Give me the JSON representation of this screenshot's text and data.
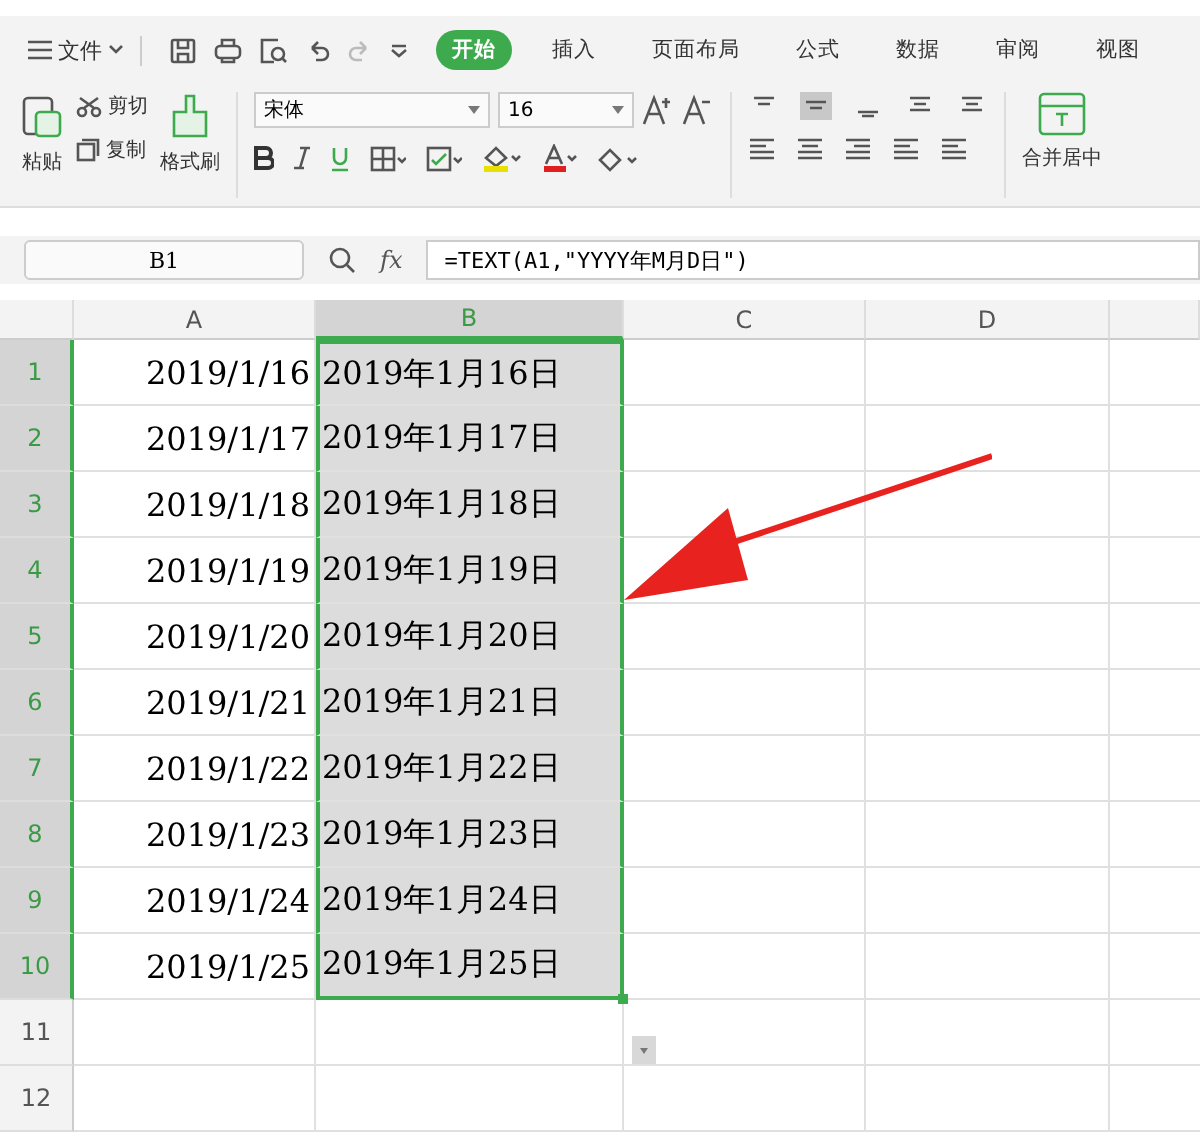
{
  "menu": {
    "file": "文件",
    "tabs": [
      {
        "label": "开始",
        "selected": true
      },
      {
        "label": "插入",
        "selected": false
      },
      {
        "label": "页面布局",
        "selected": false
      },
      {
        "label": "公式",
        "selected": false
      },
      {
        "label": "数据",
        "selected": false
      },
      {
        "label": "审阅",
        "selected": false
      },
      {
        "label": "视图",
        "selected": false
      }
    ]
  },
  "ribbon": {
    "paste": "粘贴",
    "cut": "剪切",
    "copy": "复制",
    "format_painter": "格式刷",
    "font_name": "宋体",
    "font_size": "16",
    "merge": "合并居中"
  },
  "formula_bar": {
    "name_box": "B1",
    "fx": "fx",
    "formula": "=TEXT(A1,\"YYYY年M月D日\")"
  },
  "sheet": {
    "columns": [
      {
        "label": "A",
        "selected": false
      },
      {
        "label": "B",
        "selected": true
      },
      {
        "label": "C",
        "selected": false
      },
      {
        "label": "D",
        "selected": false
      }
    ],
    "rows": [
      {
        "number": "1",
        "selected": true,
        "cells": [
          "2019/1/16",
          "2019年1月16日"
        ]
      },
      {
        "number": "2",
        "selected": true,
        "cells": [
          "2019/1/17",
          "2019年1月17日"
        ]
      },
      {
        "number": "3",
        "selected": true,
        "cells": [
          "2019/1/18",
          "2019年1月18日"
        ]
      },
      {
        "number": "4",
        "selected": true,
        "cells": [
          "2019/1/19",
          "2019年1月19日"
        ]
      },
      {
        "number": "5",
        "selected": true,
        "cells": [
          "2019/1/20",
          "2019年1月20日"
        ]
      },
      {
        "number": "6",
        "selected": true,
        "cells": [
          "2019/1/21",
          "2019年1月21日"
        ]
      },
      {
        "number": "7",
        "selected": true,
        "cells": [
          "2019/1/22",
          "2019年1月22日"
        ]
      },
      {
        "number": "8",
        "selected": true,
        "cells": [
          "2019/1/23",
          "2019年1月23日"
        ]
      },
      {
        "number": "9",
        "selected": true,
        "cells": [
          "2019/1/24",
          "2019年1月24日"
        ]
      },
      {
        "number": "10",
        "selected": true,
        "cells": [
          "2019/1/25",
          "2019年1月25日"
        ]
      },
      {
        "number": "11",
        "selected": false,
        "cells": [
          "",
          ""
        ]
      },
      {
        "number": "12",
        "selected": false,
        "cells": [
          "",
          ""
        ]
      }
    ]
  }
}
